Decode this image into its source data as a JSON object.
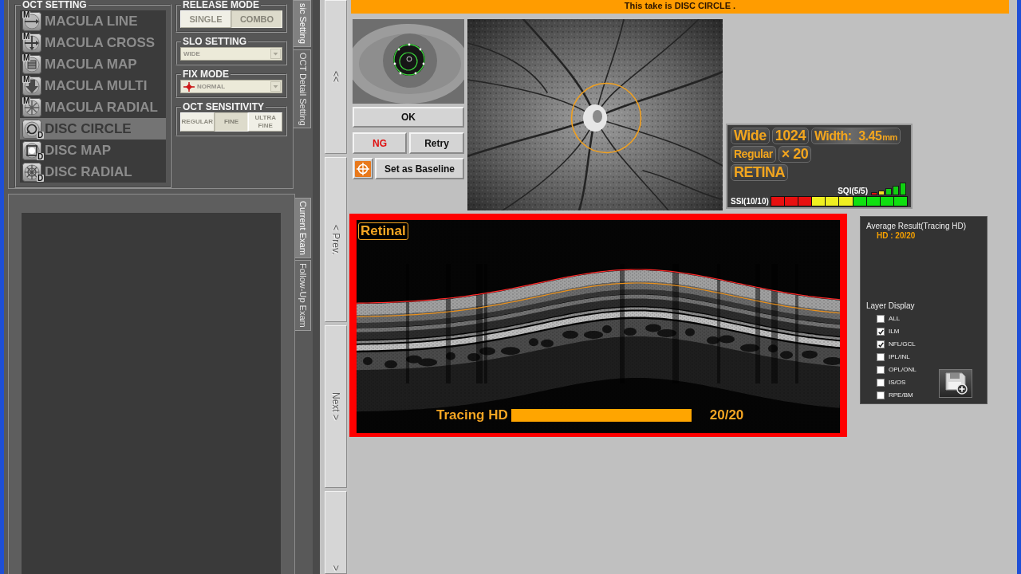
{
  "settings": {
    "tabs": [
      {
        "label": "sic Setting",
        "selected": true
      },
      {
        "label": "OCT Detail Setting",
        "selected": false
      }
    ],
    "scan_modes": {
      "title": "OCT SETTING",
      "items": [
        {
          "label": "MACULA LINE",
          "letter": "M",
          "kind": "line",
          "selected": false
        },
        {
          "label": "MACULA CROSS",
          "letter": "M",
          "kind": "cross",
          "selected": false
        },
        {
          "label": "MACULA MAP",
          "letter": "M",
          "kind": "map",
          "selected": false
        },
        {
          "label": "MACULA MULTI",
          "letter": "M",
          "kind": "multi",
          "selected": false
        },
        {
          "label": "MACULA RADIAL",
          "letter": "M",
          "kind": "radial",
          "selected": false
        },
        {
          "label": "DISC CIRCLE",
          "letter": "D",
          "kind": "circle",
          "selected": true
        },
        {
          "label": "DISC MAP",
          "letter": "D",
          "kind": "disc-map",
          "selected": false
        },
        {
          "label": "DISC RADIAL",
          "letter": "D",
          "kind": "disc-radial",
          "selected": false
        }
      ]
    },
    "release_mode": {
      "title": "RELEASE MODE",
      "options": [
        {
          "label": "SINGLE",
          "selected": false
        },
        {
          "label": "COMBO",
          "selected": true
        }
      ]
    },
    "slo_setting": {
      "title": "SLO SETTING",
      "value": "WIDE"
    },
    "fix_mode": {
      "title": "FIX MODE",
      "value": "NORMAL"
    },
    "oct_sensitivity": {
      "title": "OCT SENSITIVITY",
      "options": [
        {
          "label": "REGULAR",
          "selected": false
        },
        {
          "label": "FINE",
          "selected": true
        },
        {
          "label": "ULTRA FINE",
          "selected": false
        }
      ]
    }
  },
  "exam_tabs": [
    {
      "label": "Current Exam",
      "selected": true
    },
    {
      "label": "Follow-Up Exam",
      "selected": false
    }
  ],
  "nav_buttons": [
    "<<",
    "< Prev.",
    "Next >",
    ">"
  ],
  "banner": "This take is DISC CIRCLE .",
  "capture": {
    "ok": "OK",
    "ng": "NG",
    "retry": "Retry",
    "baseline": "Set as Baseline"
  },
  "scan_info": {
    "chip_rows": [
      [
        "Wide",
        "1024"
      ],
      [
        "Regular",
        "× 20"
      ],
      [
        "RETINA"
      ]
    ],
    "width": {
      "label": "Width:",
      "value": "3.45",
      "unit": "mm"
    },
    "sqi": {
      "label": "SQI(5/5)"
    },
    "ssi": {
      "label": "SSI(10/10)",
      "level": 1
    }
  },
  "oct_scan": {
    "layer_label": "Retinal",
    "progress": {
      "label": "Tracing HD",
      "level": 1,
      "reading": "20/20"
    }
  },
  "result_panel": {
    "title": "Average Result(Tracing HD)",
    "value": "HD : 20/20",
    "layer_title": "Layer Display",
    "layers": [
      {
        "label": "ALL",
        "checked": false
      },
      {
        "label": "ILM",
        "checked": true
      },
      {
        "label": "NFL/GCL",
        "checked": true
      },
      {
        "label": "IPL/INL",
        "checked": false
      },
      {
        "label": "OPL/ONL",
        "checked": false
      },
      {
        "label": "IS/OS",
        "checked": false
      },
      {
        "label": "RPE/BM",
        "checked": false
      }
    ]
  }
}
